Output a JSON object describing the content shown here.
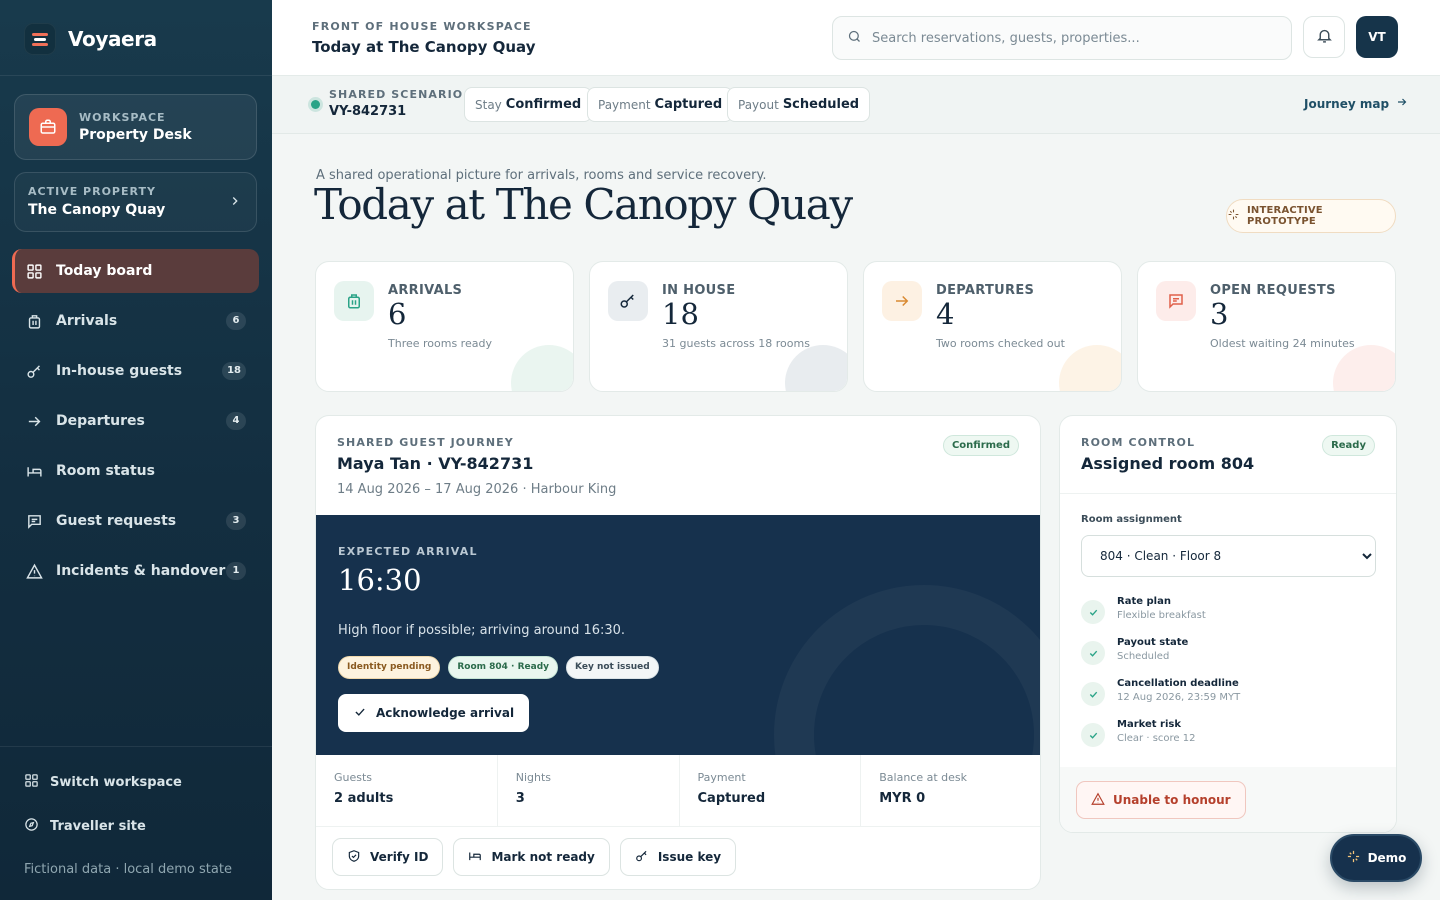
{
  "brand": {
    "name": "Voyaera"
  },
  "workspace": {
    "kicker": "WORKSPACE",
    "name": "Property Desk"
  },
  "property": {
    "kicker": "ACTIVE PROPERTY",
    "name": "The Canopy Quay"
  },
  "nav": [
    {
      "label": "Today board",
      "count": "",
      "icon": "grid-icon",
      "active": true
    },
    {
      "label": "Arrivals",
      "count": "6",
      "icon": "luggage-icon"
    },
    {
      "label": "In-house guests",
      "count": "18",
      "icon": "key-icon"
    },
    {
      "label": "Departures",
      "count": "4",
      "icon": "arrow-right-icon"
    },
    {
      "label": "Room status",
      "count": "",
      "icon": "bed-icon"
    },
    {
      "label": "Guest requests",
      "count": "3",
      "icon": "message-icon"
    },
    {
      "label": "Incidents & handover",
      "count": "1",
      "icon": "warning-icon"
    }
  ],
  "sidebar_bottom": {
    "switch_label": "Switch workspace",
    "traveller_label": "Traveller site",
    "footnote": "Fictional data · local demo state"
  },
  "topbar": {
    "kicker": "FRONT OF HOUSE WORKSPACE",
    "title": "Today at The Canopy Quay",
    "search_placeholder": "Search reservations, guests, properties...",
    "avatar_initials": "VT"
  },
  "scenario": {
    "kicker": "SHARED SCENARIO",
    "id": "VY-842731",
    "pills": [
      {
        "label": "Stay",
        "value": "Confirmed"
      },
      {
        "label": "Payment",
        "value": "Captured"
      },
      {
        "label": "Payout",
        "value": "Scheduled"
      }
    ],
    "journey_link": "Journey map"
  },
  "hero": {
    "subtitle": "A shared operational picture for arrivals, rooms and service recovery.",
    "title": "Today at The Canopy Quay",
    "prototype_label": "INTERACTIVE PROTOTYPE"
  },
  "stats": [
    {
      "label": "ARRIVALS",
      "value": "6",
      "note": "Three rooms ready",
      "color": "#e7f4ef"
    },
    {
      "label": "IN HOUSE",
      "value": "18",
      "note": "31 guests across 18 rooms",
      "color": "#e9edf0"
    },
    {
      "label": "DEPARTURES",
      "value": "4",
      "note": "Two rooms checked out",
      "color": "#fdf1e3"
    },
    {
      "label": "OPEN REQUESTS",
      "value": "3",
      "note": "Oldest waiting 24 minutes",
      "color": "#fdecea"
    }
  ],
  "journey": {
    "kicker": "SHARED GUEST JOURNEY",
    "title": "Maya Tan · VY-842731",
    "dates": "14 Aug 2026 – 17 Aug 2026 · Harbour King",
    "badge": "Confirmed",
    "arrival": {
      "kicker": "EXPECTED ARRIVAL",
      "time": "16:30",
      "note": "High floor if possible; arriving around 16:30.",
      "chips": [
        "Identity pending",
        "Room 804 · Ready",
        "Key not issued"
      ],
      "ack_label": "Acknowledge arrival"
    },
    "facts": [
      {
        "label": "Guests",
        "value": "2 adults"
      },
      {
        "label": "Nights",
        "value": "3"
      },
      {
        "label": "Payment",
        "value": "Captured"
      },
      {
        "label": "Balance at desk",
        "value": "MYR 0"
      }
    ],
    "actions": [
      "Verify ID",
      "Mark not ready",
      "Issue key"
    ]
  },
  "room": {
    "kicker": "ROOM CONTROL",
    "title": "Assigned room 804",
    "badge": "Ready",
    "assignment_label": "Room assignment",
    "assignment_value": "804 · Clean · Floor 8",
    "checks": [
      {
        "title": "Rate plan",
        "value": "Flexible breakfast"
      },
      {
        "title": "Payout state",
        "value": "Scheduled"
      },
      {
        "title": "Cancellation deadline",
        "value": "12 Aug 2026, 23:59 MYT"
      },
      {
        "title": "Market risk",
        "value": "Clear · score 12"
      }
    ],
    "danger_label": "Unable to honour"
  },
  "demo_label": "Demo",
  "colors": {
    "accent": "#ee6a52",
    "navy": "#16314d",
    "success": "#2aa387"
  }
}
